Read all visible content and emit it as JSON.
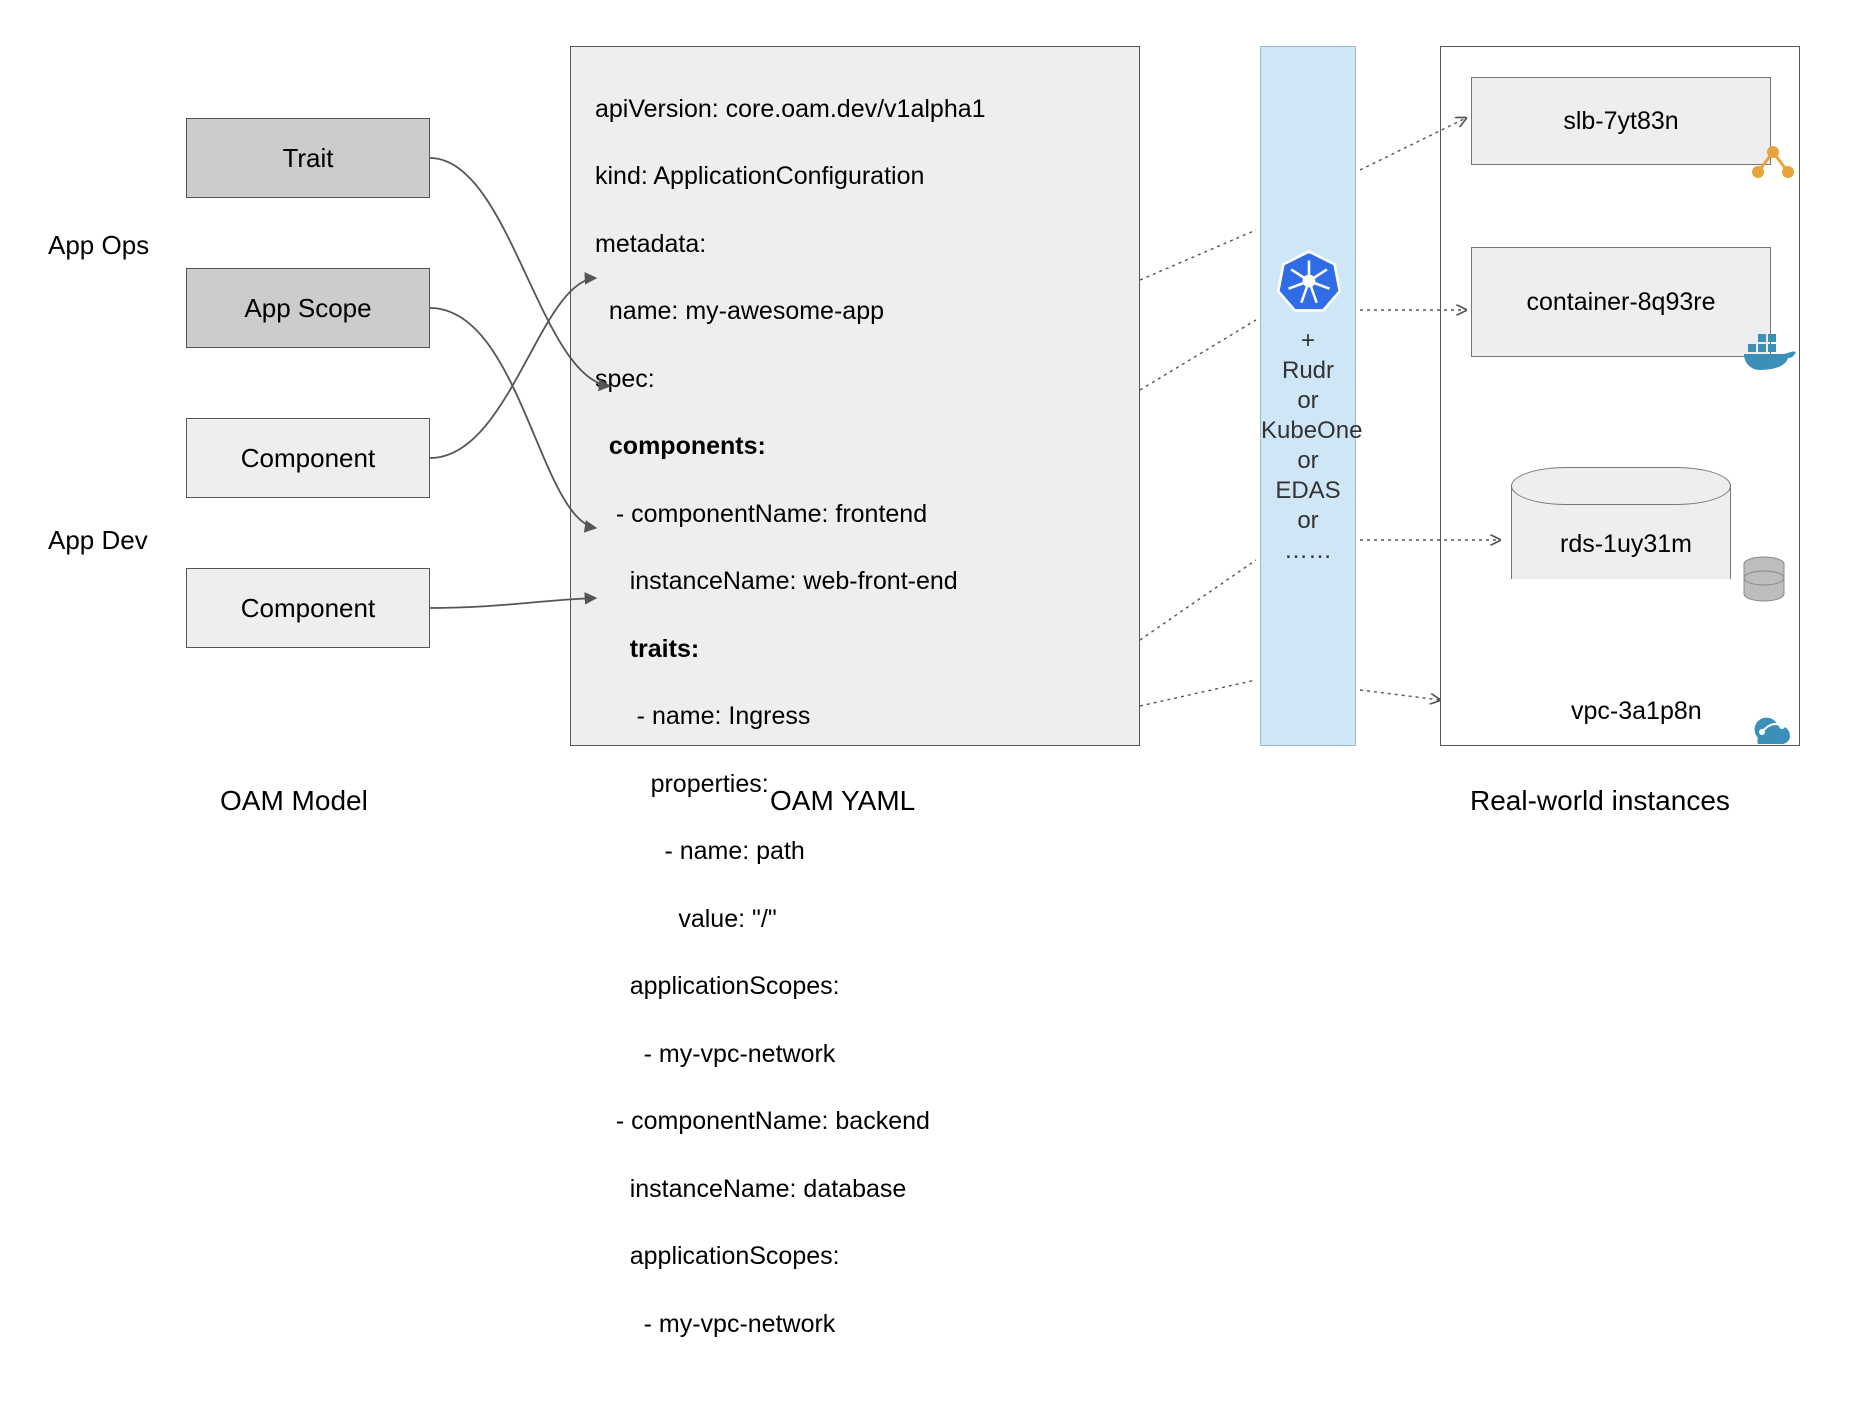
{
  "roles": {
    "ops": "App Ops",
    "dev": "App Dev"
  },
  "model": {
    "trait": "Trait",
    "scope": "App Scope",
    "component": "Component",
    "title": "OAM Model"
  },
  "yaml": {
    "title": "OAM YAML",
    "lines": {
      "apiVersion": "apiVersion: core.oam.dev/v1alpha1",
      "kind": "kind: ApplicationConfiguration",
      "metadata": "metadata:",
      "metaName": "  name: my-awesome-app",
      "spec": "spec:",
      "components": "  components:",
      "comp1Name": "   - componentName: frontend",
      "comp1Inst": "     instanceName: web-front-end",
      "traits": "     traits:",
      "traitName": "      - name: Ingress",
      "traitProps": "        properties:",
      "traitPropName": "          - name: path",
      "traitPropValue": "            value: \"/\"",
      "appScopes1": "     applicationScopes:",
      "appScopes1Val": "       - my-vpc-network",
      "comp2Name": "   - componentName: backend",
      "comp2Inst": "     instanceName: database",
      "appScopes2": "     applicationScopes:",
      "appScopes2Val": "       - my-vpc-network"
    }
  },
  "runtime": {
    "plus": "+",
    "items": [
      "Rudr",
      "or",
      "KubeOne",
      "or",
      "EDAS",
      "or",
      "……"
    ]
  },
  "instances": {
    "title": "Real-world instances",
    "slb": "slb-7yt83n",
    "container": "container-8q93re",
    "rds": "rds-1uy31m",
    "vpc": "vpc-3a1p8n"
  }
}
